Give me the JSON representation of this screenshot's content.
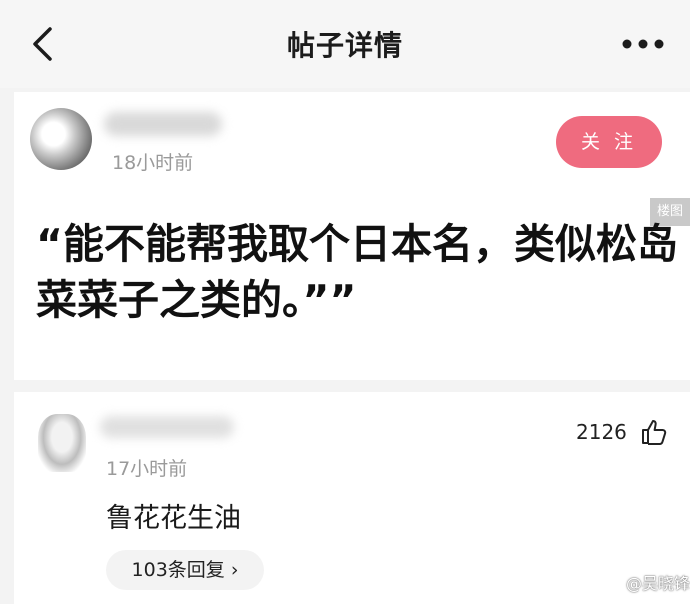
{
  "header": {
    "title": "帖子详情",
    "back_icon": "chevron-left-icon",
    "more_icon": "more-horizontal-icon"
  },
  "post": {
    "time": "18小时前",
    "follow_label": "关 注",
    "image_tag": "楼图",
    "content": "“能不能帮我取个日本名，类似松岛菜菜子之类的。””"
  },
  "comment": {
    "time": "17小时前",
    "text": "鲁花花生油",
    "likes": "2126",
    "like_icon": "thumbs-up-icon",
    "reply_label": "103条回复 ›"
  },
  "watermark": {
    "icon": "weibo-icon",
    "text": "@吴晓锋"
  },
  "colors": {
    "follow_button": "#ef6b7f",
    "background": "#f3f3f3",
    "card": "#ffffff",
    "meta_text": "#9a9a9a"
  }
}
